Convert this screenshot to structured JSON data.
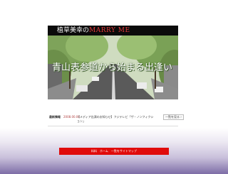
{
  "header": {
    "title_prefix": "植草美幸の",
    "brand": "MARRY ME"
  },
  "hero": {
    "caption": "青山表参道から始まる出逢い"
  },
  "news": {
    "label": "最新情報",
    "date": "2008.00.00",
    "text": "【メディア出演のお知らせ】フジテレビ「ザ・ノンフィクション」",
    "more": "一覧を見る ›"
  },
  "footer": {
    "links": "料料　ホーム　一覧をサイトマップ"
  },
  "colors": {
    "header_bg": "#0b0b0b",
    "brand": "#e33a3a",
    "footer_bg": "#e00b0b",
    "page_bottom": "#7d6da6"
  },
  "icons": [
    "chevron-right-icon"
  ]
}
